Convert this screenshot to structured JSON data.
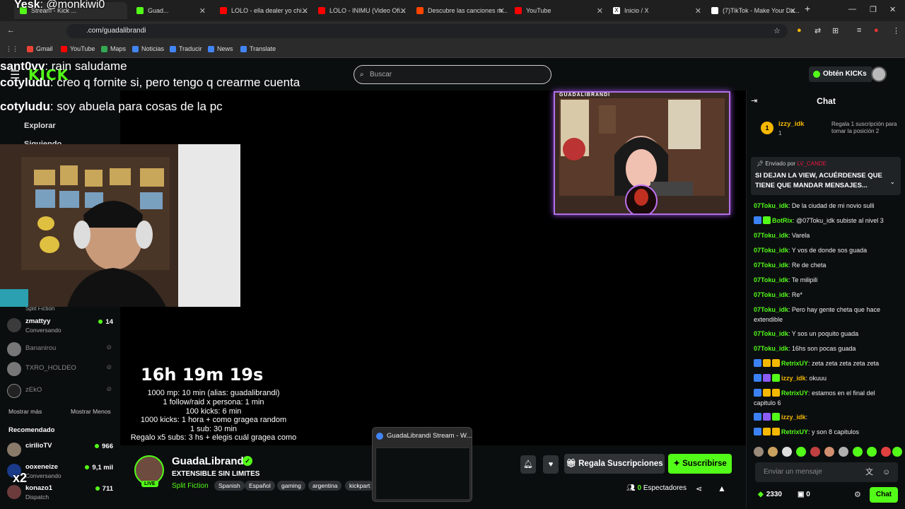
{
  "browser": {
    "tabs": [
      {
        "label": "Stream - Kick ...",
        "color": "#53fc18"
      },
      {
        "label": "Guad...",
        "color": "#53fc18"
      },
      {
        "label": "LOLO - ella dealer yo chi...",
        "color": "#ff0000"
      },
      {
        "label": "LOLO - INIMU (Video Ofi...",
        "color": "#ff0000"
      },
      {
        "label": "Descubre las canciones m...",
        "color": "#ff4500"
      },
      {
        "label": "YouTube",
        "color": "#ff0000"
      },
      {
        "label": "Inicio / X",
        "color": "#ffffff"
      },
      {
        "label": "(7)TikTok - Make Your Da...",
        "color": "#ffffff"
      }
    ],
    "new_tab": "+",
    "url": ".com/guadalibrandi",
    "bookmarks": [
      "Gmail",
      "YouTube",
      "Maps",
      "Noticias",
      "Traducir",
      "News",
      "Translate"
    ]
  },
  "kick": {
    "logo": "KICK",
    "search_placeholder": "Buscar",
    "get_kicks": "Obtén KICKs"
  },
  "sidebar": {
    "nav": [
      "Explorar",
      "Siguiendo"
    ],
    "partial_category": "Split Fiction",
    "following": [
      {
        "name": "zmattyy",
        "category": "Conversando",
        "viewers": "14",
        "online": true
      },
      {
        "name": "Bananirou",
        "online": false
      },
      {
        "name": "TXRO_HOLDEO",
        "online": false
      },
      {
        "name": "zEkO",
        "online": false
      }
    ],
    "show_more": "Mostrar más",
    "show_less": "Mostrar Menos",
    "recommended_label": "Recomendado",
    "recommended": [
      {
        "name": "cirilioTV",
        "category": "",
        "viewers": "966"
      },
      {
        "name": "ooxeneize",
        "category": "Conversando",
        "viewers": "9,1 mil"
      },
      {
        "name": "konazo1",
        "category": "Dispatch",
        "viewers": "711"
      }
    ],
    "overlay_badge": "x2"
  },
  "overlay_chat": [
    {
      "user": "Yesk",
      "text": ": @monkiwi0"
    },
    {
      "user": "sant0vv",
      "text": ": rain saludame"
    },
    {
      "user": "cotyludu",
      "text": ": creo q fornite si, pero tengo q crearme cuenta"
    },
    {
      "user": "cotyludu",
      "text": ": soy abuela para cosas de la pc"
    }
  ],
  "stream": {
    "cam_title": "GUADALIBRANDI",
    "timer": "16h 19m 19s",
    "rules": [
      "1000 mp: 10 min (alias: guadalibrandi)",
      "1 follow/raid x persona: 1 min",
      "100 kicks: 6 min",
      "1000 kicks: 1 hora + como gragea random",
      "1 sub: 30 min",
      "Regalo x5 subs: 3 hs + elegis cuál gragea como"
    ]
  },
  "channel": {
    "name": "GuadaLibrandi",
    "title": "EXTENSIBLE SIN LIMITES",
    "category": "Split Fiction",
    "live": "LIVE",
    "tags": [
      "Spanish",
      "Español",
      "gaming",
      "argentina",
      "kickpart"
    ],
    "gift_subs": "Regala Suscripciones",
    "subscribe": "Suscribirse",
    "viewers_count": "0",
    "viewers_label": "Espectadores"
  },
  "tab_preview": {
    "title": "GuadaLibrandi Stream - W..."
  },
  "chat": {
    "title": "Chat",
    "top_gifter": {
      "rank": "1",
      "name": "izzy_idk",
      "count": "1",
      "note": "Regala 1 suscripción para tomar la posición 2"
    },
    "pinned": {
      "header_prefix": "Enviado por",
      "header_user": "LV_CANDE",
      "message": "SI DEJAN LA VIEW, ACUÉRDENSE QUE TIENE QUE MANDAR MENSAJES..."
    },
    "messages": [
      {
        "user": "07Toku_idk",
        "color": "#53fc18",
        "text": ": De la ciudad de mi novio sulli",
        "badges": []
      },
      {
        "user": "BotRix",
        "color": "#53fc18",
        "text": ": @07Toku_idk subiste al nivel 3",
        "badges": [
          "#3b82f6",
          "#53fc18"
        ]
      },
      {
        "user": "07Toku_idk",
        "color": "#53fc18",
        "text": ": Varela",
        "badges": []
      },
      {
        "user": "07Toku_idk",
        "color": "#53fc18",
        "text": ": Y vos de donde sos guada",
        "badges": []
      },
      {
        "user": "07Toku_idk",
        "color": "#53fc18",
        "text": ": Re de cheta",
        "badges": []
      },
      {
        "user": "07Toku_idk",
        "color": "#53fc18",
        "text": ": Te milipili",
        "badges": []
      },
      {
        "user": "07Toku_idk",
        "color": "#53fc18",
        "text": ": Re*",
        "badges": []
      },
      {
        "user": "07Toku_idk",
        "color": "#53fc18",
        "text": ": Pero hay gente cheta que hace extendible",
        "badges": []
      },
      {
        "user": "07Toku_idk",
        "color": "#53fc18",
        "text": ": Y sos un poquito guada",
        "badges": []
      },
      {
        "user": "07Toku_idk",
        "color": "#53fc18",
        "text": ": 16hs son pocas guada",
        "badges": []
      },
      {
        "user": "RetrixUY",
        "color": "#53fc18",
        "text": ": zeta zeta zeta zeta zeta",
        "badges": [
          "#3b82f6",
          "#f5b800",
          "#f5b800"
        ]
      },
      {
        "user": "izzy_idk",
        "color": "#f5b800",
        "text": ": okuuu",
        "badges": [
          "#3b82f6",
          "#8b5cf6",
          "#53fc18"
        ]
      },
      {
        "user": "RetrixUY",
        "color": "#53fc18",
        "text": ": estamos en el final del capitulo 6",
        "badges": [
          "#3b82f6",
          "#f5b800",
          "#f5b800"
        ]
      },
      {
        "user": "izzy_idk",
        "color": "#f5b800",
        "text": ":",
        "badges": [
          "#3b82f6",
          "#8b5cf6",
          "#53fc18"
        ]
      },
      {
        "user": "RetrixUY",
        "color": "#53fc18",
        "text": ": y son 8 capitulos",
        "badges": [
          "#3b82f6",
          "#f5b800",
          "#f5b800"
        ]
      }
    ],
    "input_placeholder": "Enviar un mensaje",
    "kicks_balance": "2330",
    "other_balance": "0",
    "send_label": "Chat"
  }
}
